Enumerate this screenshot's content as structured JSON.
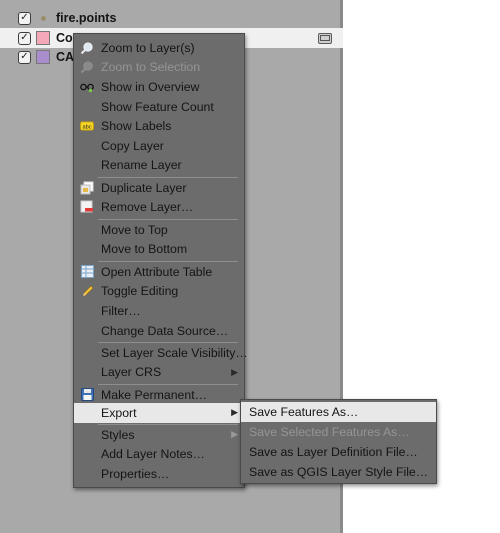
{
  "layers": [
    {
      "name": "fire.points",
      "checked": true,
      "symbol": "dot",
      "color": "#9a8f6a"
    },
    {
      "name": "Co",
      "checked": true,
      "symbol": "box",
      "color": "#f4a8b8",
      "selected": true
    },
    {
      "name": "CA",
      "checked": true,
      "symbol": "box",
      "color": "#a98dcc"
    }
  ],
  "context_menu": {
    "items": {
      "zoom_to_layer": "Zoom to Layer(s)",
      "zoom_to_selection": "Zoom to Selection",
      "show_in_overview": "Show in Overview",
      "show_feature_count": "Show Feature Count",
      "show_labels": "Show Labels",
      "copy_layer": "Copy Layer",
      "rename_layer": "Rename Layer",
      "duplicate_layer": "Duplicate Layer",
      "remove_layer": "Remove Layer…",
      "move_to_top": "Move to Top",
      "move_to_bottom": "Move to Bottom",
      "open_attribute_table": "Open Attribute Table",
      "toggle_editing": "Toggle Editing",
      "filter": "Filter…",
      "change_data_source": "Change Data Source…",
      "set_layer_scale_visibility": "Set Layer Scale Visibility…",
      "layer_crs": "Layer CRS",
      "make_permanent": "Make Permanent…",
      "export": "Export",
      "styles": "Styles",
      "add_layer_notes": "Add Layer Notes…",
      "properties": "Properties…"
    }
  },
  "export_submenu": {
    "items": {
      "save_features_as": "Save Features As…",
      "save_selected_features_as": "Save Selected Features As…",
      "save_as_layer_definition": "Save as Layer Definition File…",
      "save_as_qgis_style": "Save as QGIS Layer Style File…"
    }
  },
  "icons": {
    "checkbox": "checkmark-icon",
    "submenu": "chevron-right-icon",
    "labels_badge": "abc"
  },
  "colors": {
    "panel_bg": "#a9a9a9",
    "menu_bg": "#6c6c6c",
    "highlight": "#e8e8e8",
    "disabled_text": "#959595"
  }
}
